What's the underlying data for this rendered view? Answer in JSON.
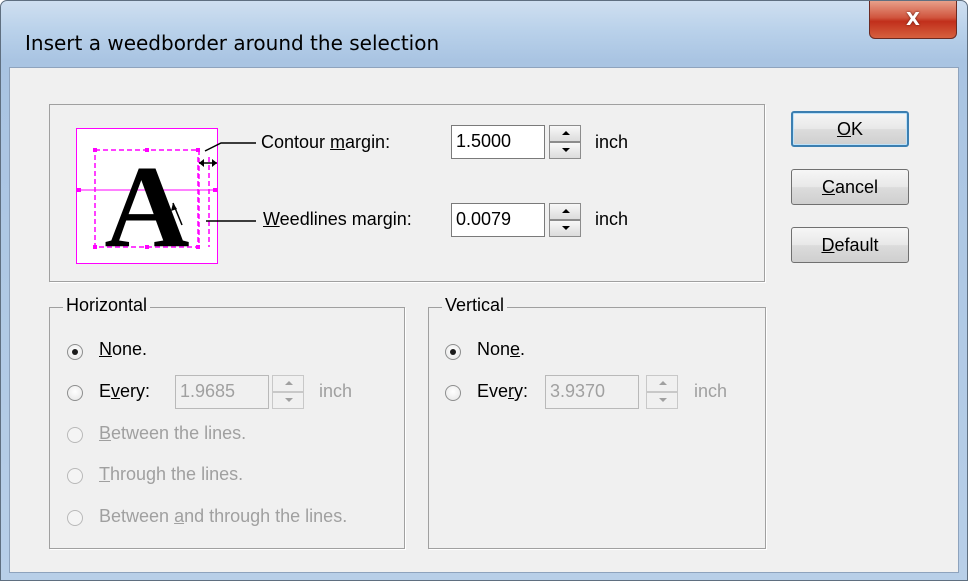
{
  "dialog": {
    "title": "Insert a weedborder around the selection",
    "close_glyph": "X"
  },
  "preview": {
    "glyph": "A",
    "accent_color": "#ff00ff"
  },
  "margins": {
    "contour_label_pre": "Contour ",
    "contour_label_acc": "m",
    "contour_label_post": "argin:",
    "contour_value": "1.5000",
    "contour_unit": "inch",
    "weedlines_label_acc": "W",
    "weedlines_label_post": "eedlines margin:",
    "weedlines_value": "0.0079",
    "weedlines_unit": "inch"
  },
  "buttons": {
    "ok_acc": "O",
    "ok_post": "K",
    "cancel_acc": "C",
    "cancel_post": "ancel",
    "default_acc": "D",
    "default_post": "efault"
  },
  "horizontal": {
    "legend": "Horizontal",
    "none_acc": "N",
    "none_post": "one.",
    "every_pre": "E",
    "every_acc": "v",
    "every_post": "ery:",
    "every_value": "1.9685",
    "every_unit": "inch",
    "between_acc": "B",
    "between_post": "etween the lines.",
    "through_acc": "T",
    "through_post": "hrough the lines.",
    "both_pre": "Between ",
    "both_acc": "a",
    "both_post": "nd through the lines.",
    "selected": "none"
  },
  "vertical": {
    "legend": "Vertical",
    "none_pre": "Non",
    "none_acc": "e",
    "none_post": ".",
    "every_pre": "Eve",
    "every_acc": "r",
    "every_post": "y:",
    "every_value": "3.9370",
    "every_unit": "inch",
    "selected": "none"
  }
}
